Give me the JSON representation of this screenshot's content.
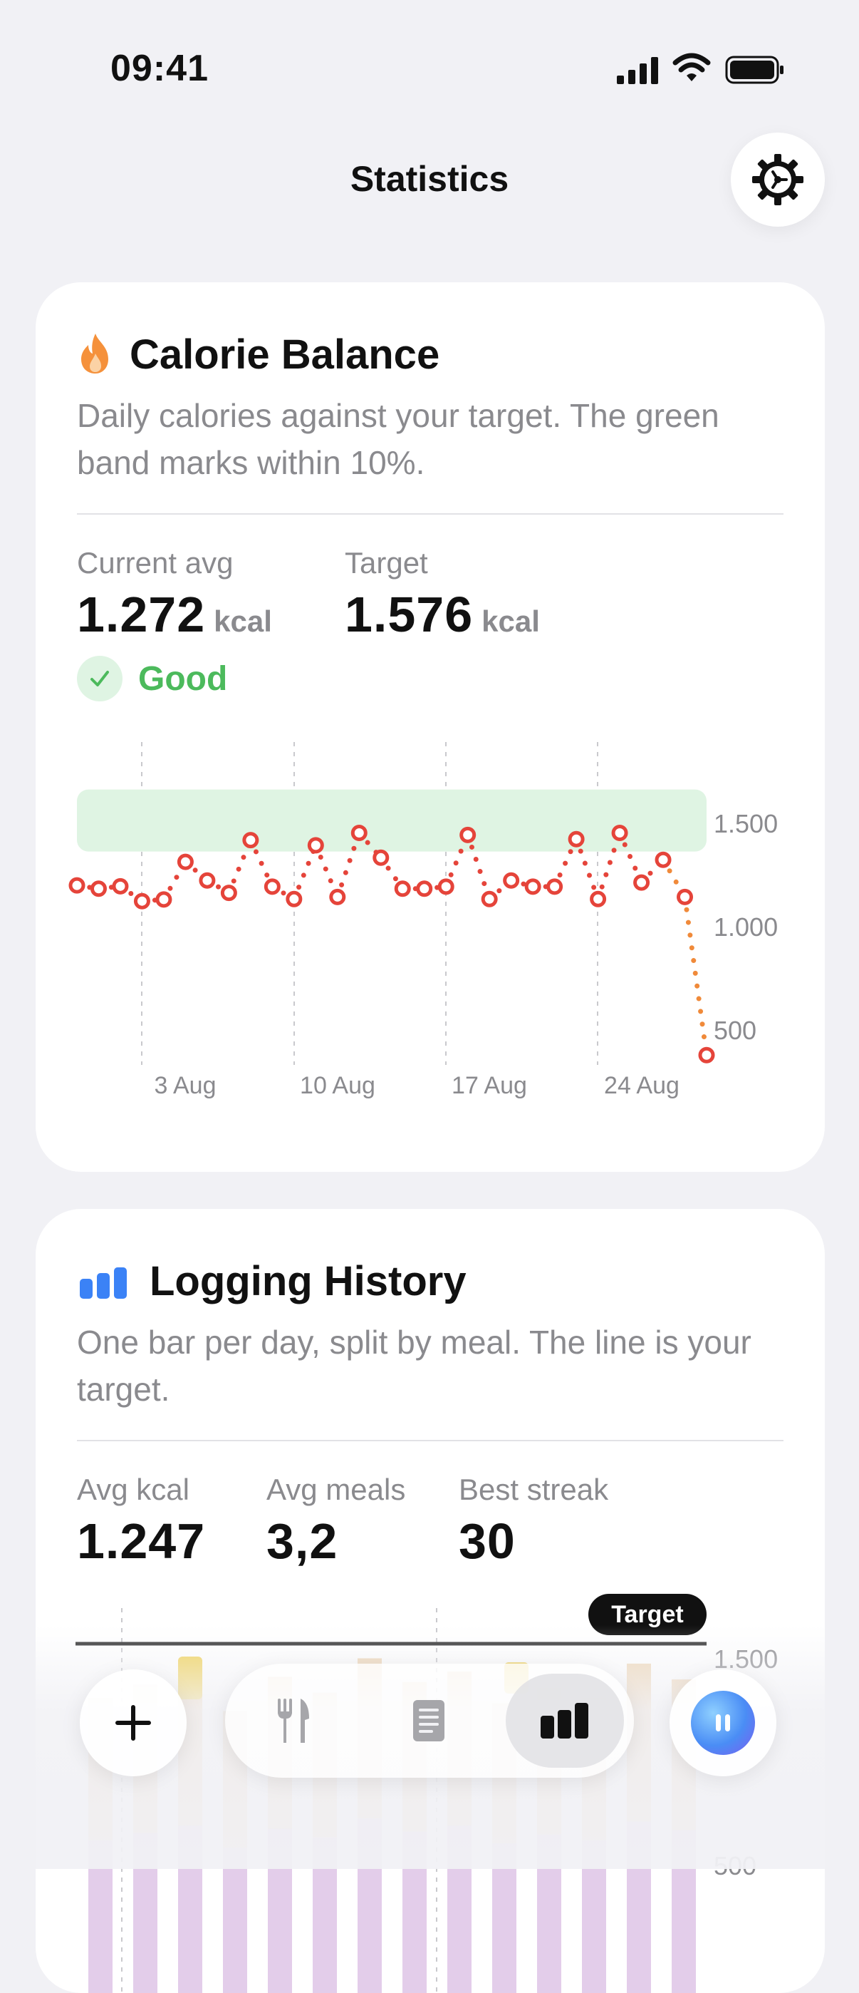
{
  "status_bar": {
    "time": "09:41",
    "icons": [
      "signal-icon",
      "wifi-icon",
      "battery-icon"
    ]
  },
  "header": {
    "title": "Statistics",
    "settings_icon": "gear-icon"
  },
  "calorie_card": {
    "icon": "flame-icon",
    "title": "Calorie Balance",
    "description": "Daily calories against your target. The green band marks within 10%.",
    "stats": [
      {
        "label": "Current avg",
        "value": "1.272",
        "unit": "kcal"
      },
      {
        "label": "Target",
        "value": "1.576",
        "unit": "kcal"
      }
    ],
    "status": {
      "label": "Good",
      "icon": "check-icon"
    }
  },
  "logging_card": {
    "icon": "bar-chart-icon",
    "title": "Logging History",
    "description": "One bar per day, split by meal. The line is your target.",
    "stats": [
      {
        "label": "Avg kcal",
        "value": "1.247"
      },
      {
        "label": "Avg meals",
        "value": "3,2"
      },
      {
        "label": "Best streak",
        "value": "30"
      }
    ],
    "target_label": "Target"
  },
  "tab_bar": {
    "add_icon": "plus-icon",
    "tabs": [
      {
        "name": "food",
        "icon": "fork-knife-icon",
        "active": false
      },
      {
        "name": "journal",
        "icon": "notebook-icon",
        "active": false
      },
      {
        "name": "stats",
        "icon": "bar-chart-icon",
        "active": true
      }
    ],
    "assistant_icon": "pause-icon"
  },
  "colors": {
    "accent_red": "#e5443a",
    "line_orange": "#f08a3a",
    "band_green": "#dff4e3",
    "good_green": "#4cba5c",
    "blue": "#3b82f6"
  },
  "chart_data": [
    {
      "type": "line",
      "x_ticks": [
        "3 Aug",
        "10 Aug",
        "17 Aug",
        "24 Aug"
      ],
      "y_ticks": [
        "1.500",
        "1.000",
        "500"
      ],
      "ylim": [
        350,
        1750
      ],
      "band": [
        1360,
        1660
      ],
      "series": [
        {
          "values": [
            1196,
            1180,
            1192,
            1120,
            1128,
            1310,
            1220,
            1160,
            1415,
            1190,
            1130,
            1390,
            1140,
            1450,
            1330,
            1180,
            1180,
            1190,
            1440,
            1130,
            1220,
            1190,
            1190,
            1420,
            1130,
            1450,
            1210,
            1320,
            1140,
            375
          ]
        }
      ]
    },
    {
      "type": "bar",
      "y_ticks": [
        "1.500",
        "500"
      ],
      "ylim": [
        0,
        1900
      ],
      "target": 1576,
      "series": [
        {
          "name": "",
          "values": [
            1200,
            1250,
            1300,
            1150,
            1280,
            1220,
            1350,
            1260,
            1300,
            1180,
            1240,
            1200,
            1330,
            1270
          ]
        }
      ]
    }
  ]
}
